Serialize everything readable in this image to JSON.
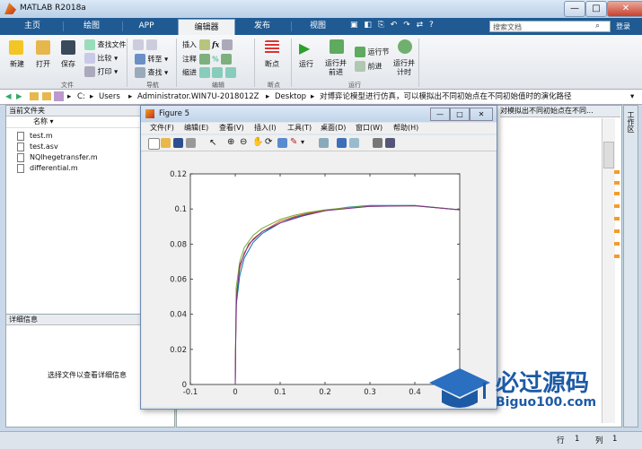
{
  "window": {
    "title": "MATLAB R2018a",
    "minimize": "—",
    "maximize": "□",
    "close": "✕"
  },
  "tabs": [
    "主页",
    "绘图",
    "APP",
    "编辑器",
    "发布",
    "视图"
  ],
  "active_tab": "编辑器",
  "search": {
    "placeholder": "搜索文档",
    "login": "登录"
  },
  "ribbon": {
    "file": {
      "new": "新建",
      "open": "打开",
      "save": "保存",
      "find_files": "查找文件",
      "compare": "比较",
      "print": "打印",
      "group": "文件"
    },
    "nav": {
      "goto": "转至",
      "find": "查找",
      "group": "导航"
    },
    "edit": {
      "insert": "插入",
      "comment": "注释",
      "indent": "缩进",
      "fx": "fx",
      "group": "编辑"
    },
    "breakpoints": {
      "label": "断点",
      "group": "断点"
    },
    "run": {
      "run": "运行",
      "run_advance": "运行并\n前进",
      "run_section": "运行节",
      "advance": "前进",
      "run_time": "运行并\n计时",
      "group": "运行"
    }
  },
  "address": {
    "segments": [
      "C:",
      "Users",
      "Administrator.WIN7U-2018012Z",
      "Desktop",
      "对博弈论模型进行仿真，可以模拟出不同初始点在不同初始值时的演化路径"
    ]
  },
  "current_folder": {
    "title": "当前文件夹",
    "column": "名称 ▾",
    "files": [
      "test.m",
      "test.asv",
      "NQlhegetransfer.m",
      "differential.m"
    ]
  },
  "details": {
    "title": "详细信息",
    "empty_msg": "选择文件以查看详细信息"
  },
  "editor_tab": "对模拟出不同初始点在不同...",
  "workspace": {
    "title": "工作区"
  },
  "status": {
    "row_label": "行",
    "row": "1",
    "col_label": "列",
    "col": "1"
  },
  "figure": {
    "title": "Figure 5",
    "menu": [
      "文件(F)",
      "编辑(E)",
      "查看(V)",
      "插入(I)",
      "工具(T)",
      "桌面(D)",
      "窗口(W)",
      "帮助(H)"
    ]
  },
  "chart_data": {
    "type": "line",
    "xlim": [
      -0.1,
      0.5
    ],
    "ylim": [
      0,
      0.12
    ],
    "xticks": [
      -0.1,
      0,
      0.1,
      0.2,
      0.3,
      0.4
    ],
    "yticks": [
      0,
      0.02,
      0.04,
      0.06,
      0.08,
      0.1,
      0.12
    ],
    "xticklabels": [
      "-0.1",
      "0",
      "0.1",
      "0.2",
      "0.3",
      "0.4"
    ],
    "yticklabels": [
      "0",
      "0.02",
      "0.04",
      "0.06",
      "0.08",
      "0.1",
      "0.12"
    ],
    "grid": false,
    "series": [
      {
        "color": "#0072bd",
        "x": [
          0,
          0.002,
          0.01,
          0.02,
          0.04,
          0.06,
          0.08,
          0.1,
          0.13,
          0.16,
          0.2,
          0.25,
          0.3,
          0.4,
          0.5
        ],
        "y": [
          0,
          0.045,
          0.062,
          0.072,
          0.081,
          0.086,
          0.089,
          0.092,
          0.095,
          0.097,
          0.099,
          0.101,
          0.102,
          0.102,
          0.0995
        ]
      },
      {
        "color": "#d95319",
        "x": [
          0,
          0.002,
          0.01,
          0.02,
          0.04,
          0.06,
          0.08,
          0.1,
          0.13,
          0.16,
          0.2,
          0.25,
          0.3,
          0.4,
          0.5
        ],
        "y": [
          0,
          0.05,
          0.066,
          0.075,
          0.083,
          0.087,
          0.09,
          0.093,
          0.0955,
          0.0975,
          0.0992,
          0.1005,
          0.1015,
          0.1018,
          0.0995
        ]
      },
      {
        "color": "#77ac30",
        "x": [
          0,
          0.002,
          0.01,
          0.02,
          0.04,
          0.06,
          0.08,
          0.1,
          0.13,
          0.16,
          0.2,
          0.25,
          0.3,
          0.4,
          0.5
        ],
        "y": [
          0,
          0.055,
          0.07,
          0.078,
          0.085,
          0.089,
          0.0915,
          0.094,
          0.0963,
          0.098,
          0.0995,
          0.1008,
          0.1017,
          0.1019,
          0.0995
        ]
      },
      {
        "color": "#7e2f8e",
        "x": [
          0,
          0.0005,
          0.003,
          0.01,
          0.03,
          0.06,
          0.1,
          0.15,
          0.2,
          0.3,
          0.4,
          0.5
        ],
        "y": [
          0,
          0.02,
          0.05,
          0.068,
          0.08,
          0.087,
          0.092,
          0.096,
          0.099,
          0.1015,
          0.1018,
          0.0995
        ]
      }
    ]
  },
  "watermark": {
    "cn": "必过源码",
    "en": "Biguo100.com"
  }
}
